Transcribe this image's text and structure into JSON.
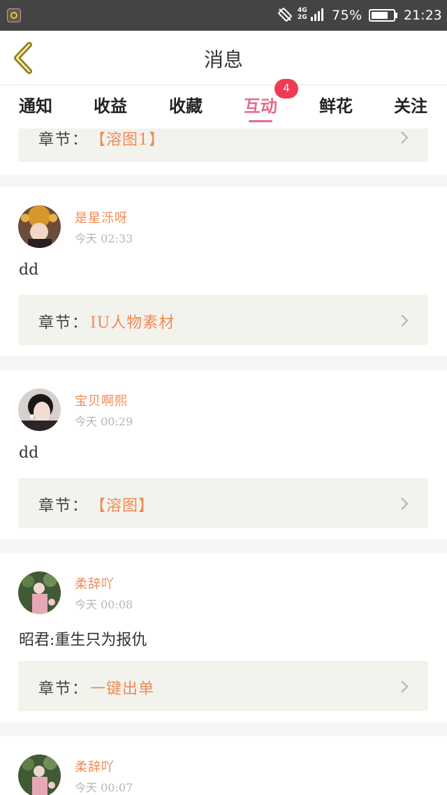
{
  "status_bar": {
    "network": "4G\n2G",
    "battery_percent": "75%",
    "battery_level": 0.75,
    "time": "21:23"
  },
  "header": {
    "title": "消息",
    "back_icon": "chevron-left-icon"
  },
  "tabs": [
    {
      "label": "通知"
    },
    {
      "label": "收益"
    },
    {
      "label": "收藏"
    },
    {
      "label": "互动",
      "active": true,
      "badge": "4"
    },
    {
      "label": "鲜花"
    },
    {
      "label": "关注"
    }
  ],
  "feed": {
    "chapter_label": "章节：",
    "top_partial": {
      "chapter": "【溶图1】"
    },
    "items": [
      {
        "user": "是星泺呀",
        "time": "今天  02:33",
        "comment": "dd",
        "chapter": "IU人物素材"
      },
      {
        "user": "宝贝啊熙",
        "time": "今天  00:29",
        "comment": "dd",
        "chapter": "【溶图】"
      },
      {
        "user": "柔辞吖",
        "time": "今天  00:08",
        "comment": "昭君:重生只为报仇",
        "chapter": "一键出单"
      },
      {
        "user": "柔辞吖",
        "time": "今天  00:07"
      }
    ]
  },
  "colors": {
    "accent": "#e26c8e",
    "badge": "#ef3b52",
    "name": "#f08a54",
    "chapter_bg": "#f3f3ee"
  }
}
